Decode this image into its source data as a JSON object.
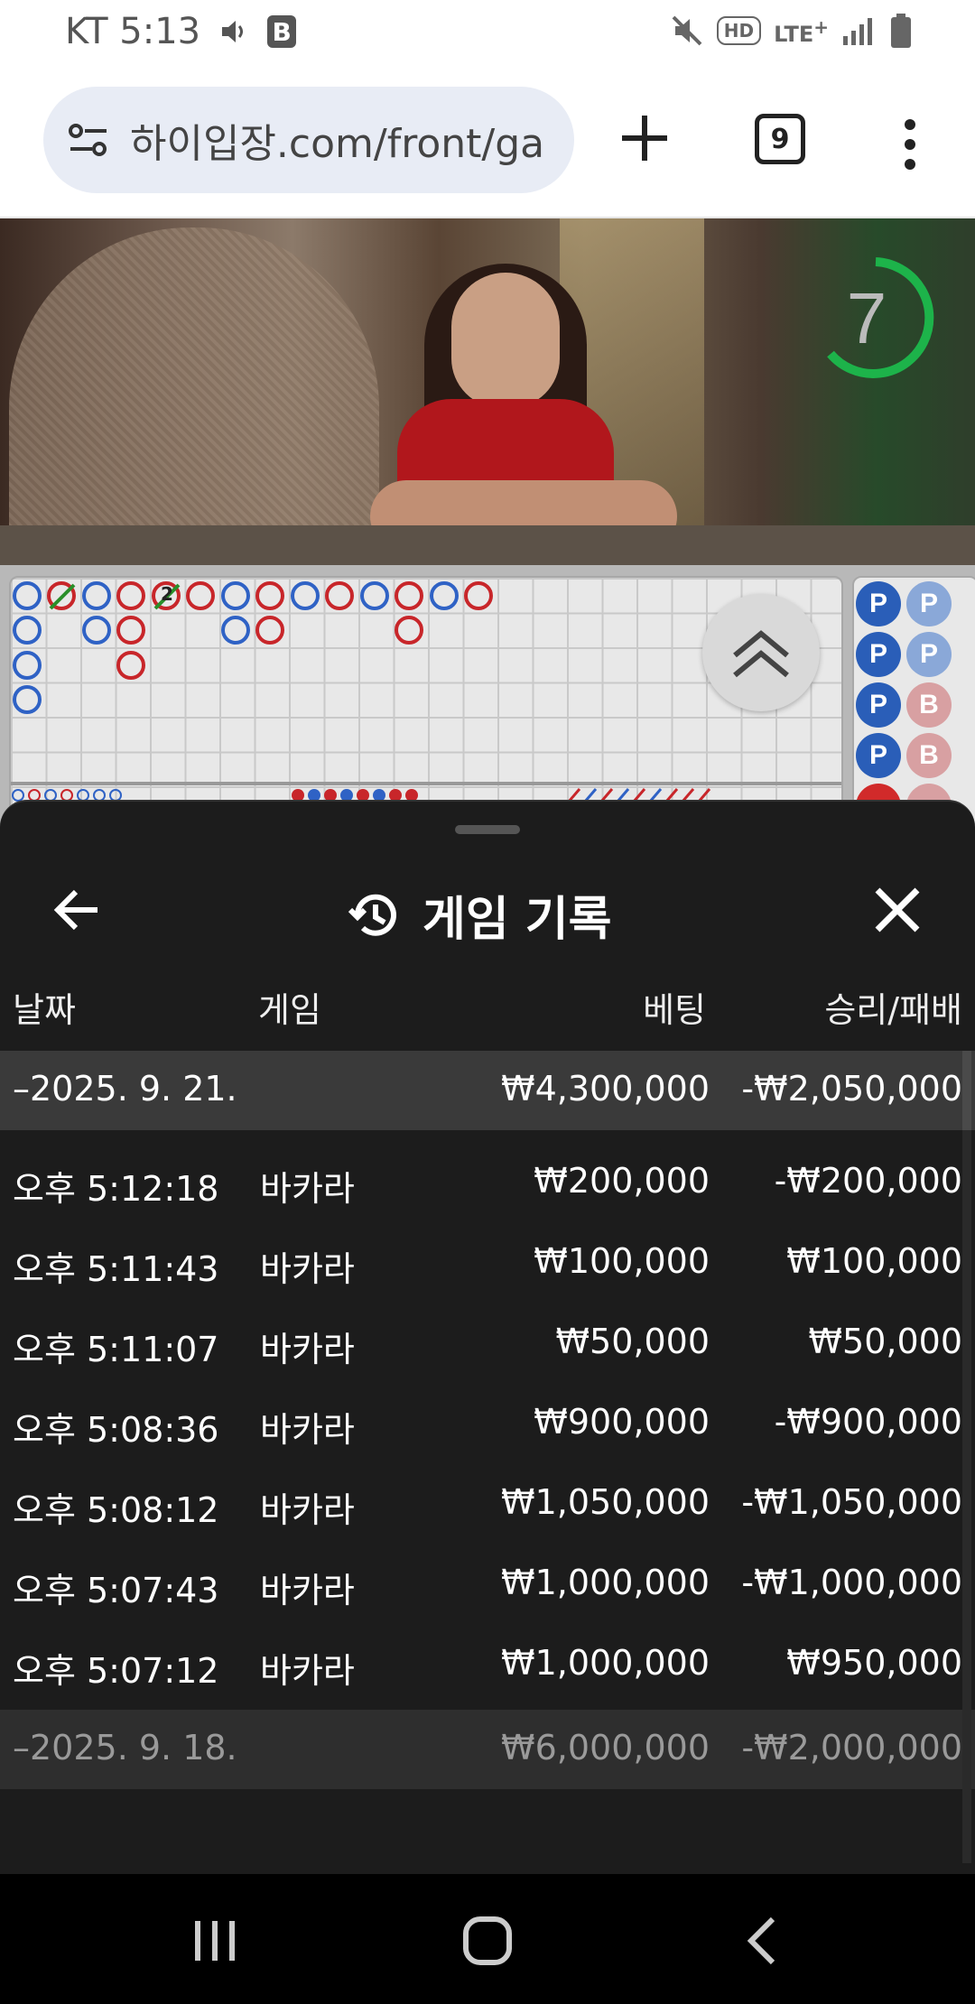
{
  "status_bar": {
    "carrier_time": "KT 5:13",
    "b_badge": "B",
    "hd": "HD",
    "lte": "LTE",
    "lte_plus": "+"
  },
  "browser": {
    "url": "하이입장.com/front/ga",
    "tab_count": "9"
  },
  "video": {
    "countdown": "7"
  },
  "roadmap": {
    "tie_count": "2",
    "bead_p": "P",
    "bead_b": "B"
  },
  "sheet": {
    "title": "게임 기록",
    "columns": {
      "date": "날짜",
      "game": "게임",
      "bet": "베팅",
      "win_loss": "승리/패배"
    },
    "days": [
      {
        "label": "–2025. 9. 21.",
        "bet": "₩4,300,000",
        "result": "-₩2,050,000",
        "rows": [
          {
            "time": "오후 5:12:18",
            "game": "바카라",
            "bet": "₩200,000",
            "result": "-₩200,000"
          },
          {
            "time": "오후 5:11:43",
            "game": "바카라",
            "bet": "₩100,000",
            "result": "₩100,000"
          },
          {
            "time": "오후 5:11:07",
            "game": "바카라",
            "bet": "₩50,000",
            "result": "₩50,000"
          },
          {
            "time": "오후 5:08:36",
            "game": "바카라",
            "bet": "₩900,000",
            "result": "-₩900,000"
          },
          {
            "time": "오후 5:08:12",
            "game": "바카라",
            "bet": "₩1,050,000",
            "result": "-₩1,050,000"
          },
          {
            "time": "오후 5:07:43",
            "game": "바카라",
            "bet": "₩1,000,000",
            "result": "-₩1,000,000"
          },
          {
            "time": "오후 5:07:12",
            "game": "바카라",
            "bet": "₩1,000,000",
            "result": "₩950,000"
          }
        ]
      },
      {
        "label": "–2025. 9. 18.",
        "bet": "₩6,000,000",
        "result": "-₩2,000,000"
      }
    ]
  },
  "icons": {
    "site_settings": "site-settings-icon",
    "history": "history-icon",
    "back": "back-arrow-icon",
    "close": "close-icon",
    "chevron_up": "double-chevron-up-icon",
    "mute": "mute-icon",
    "volume": "volume-icon"
  },
  "colors": {
    "banker": "#c8262a",
    "player": "#2f62c5",
    "sheet_bg": "#1c1c1c",
    "day_row_bg": "#3a3a3a",
    "timer": "#1db34a"
  }
}
